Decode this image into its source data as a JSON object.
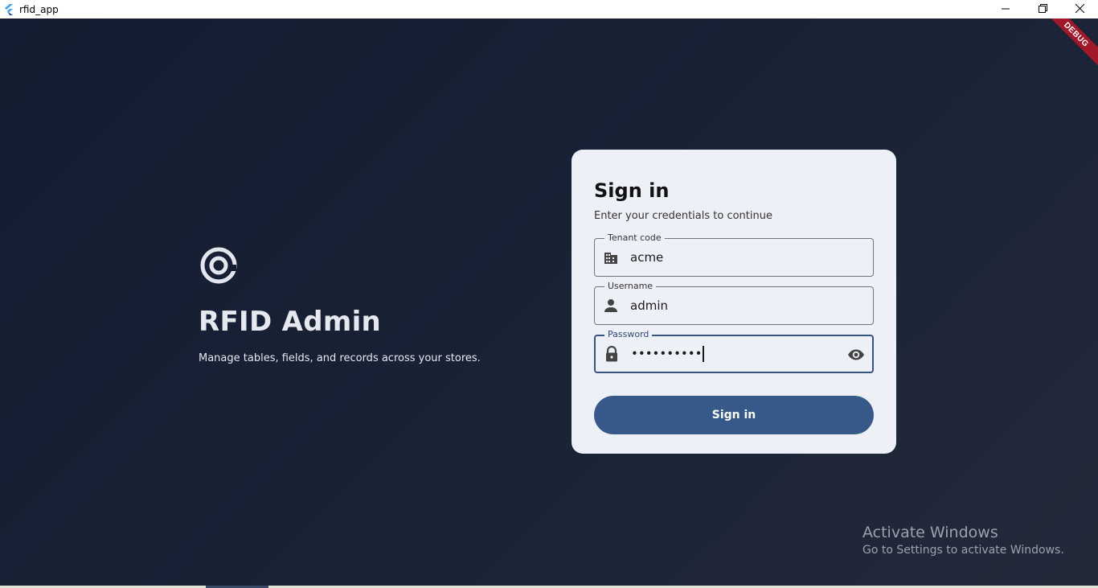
{
  "window": {
    "title": "rfid_app",
    "controls": {
      "minimize": "minimize-icon",
      "restore": "restore-icon",
      "close": "close-icon"
    }
  },
  "debug_banner": "DEBUG",
  "brand": {
    "logo_icon": "at-sign-icon",
    "title": "RFID Admin",
    "subtitle": "Manage tables, fields, and records across your stores."
  },
  "login": {
    "title": "Sign in",
    "subtitle": "Enter your credentials to continue",
    "tenant": {
      "label": "Tenant code",
      "value": "acme",
      "icon": "building-icon"
    },
    "username": {
      "label": "Username",
      "value": "admin",
      "icon": "person-icon"
    },
    "password": {
      "label": "Password",
      "masked_value": "••••••••••",
      "icon": "lock-icon",
      "toggle_icon": "eye-icon"
    },
    "submit_label": "Sign in"
  },
  "watermark": {
    "title": "Activate Windows",
    "subtitle": "Go to Settings to activate Windows."
  },
  "colors": {
    "background": "#1b2437",
    "card": "#eef0f8",
    "primary": "#36598a",
    "debug": "#a0182a"
  }
}
